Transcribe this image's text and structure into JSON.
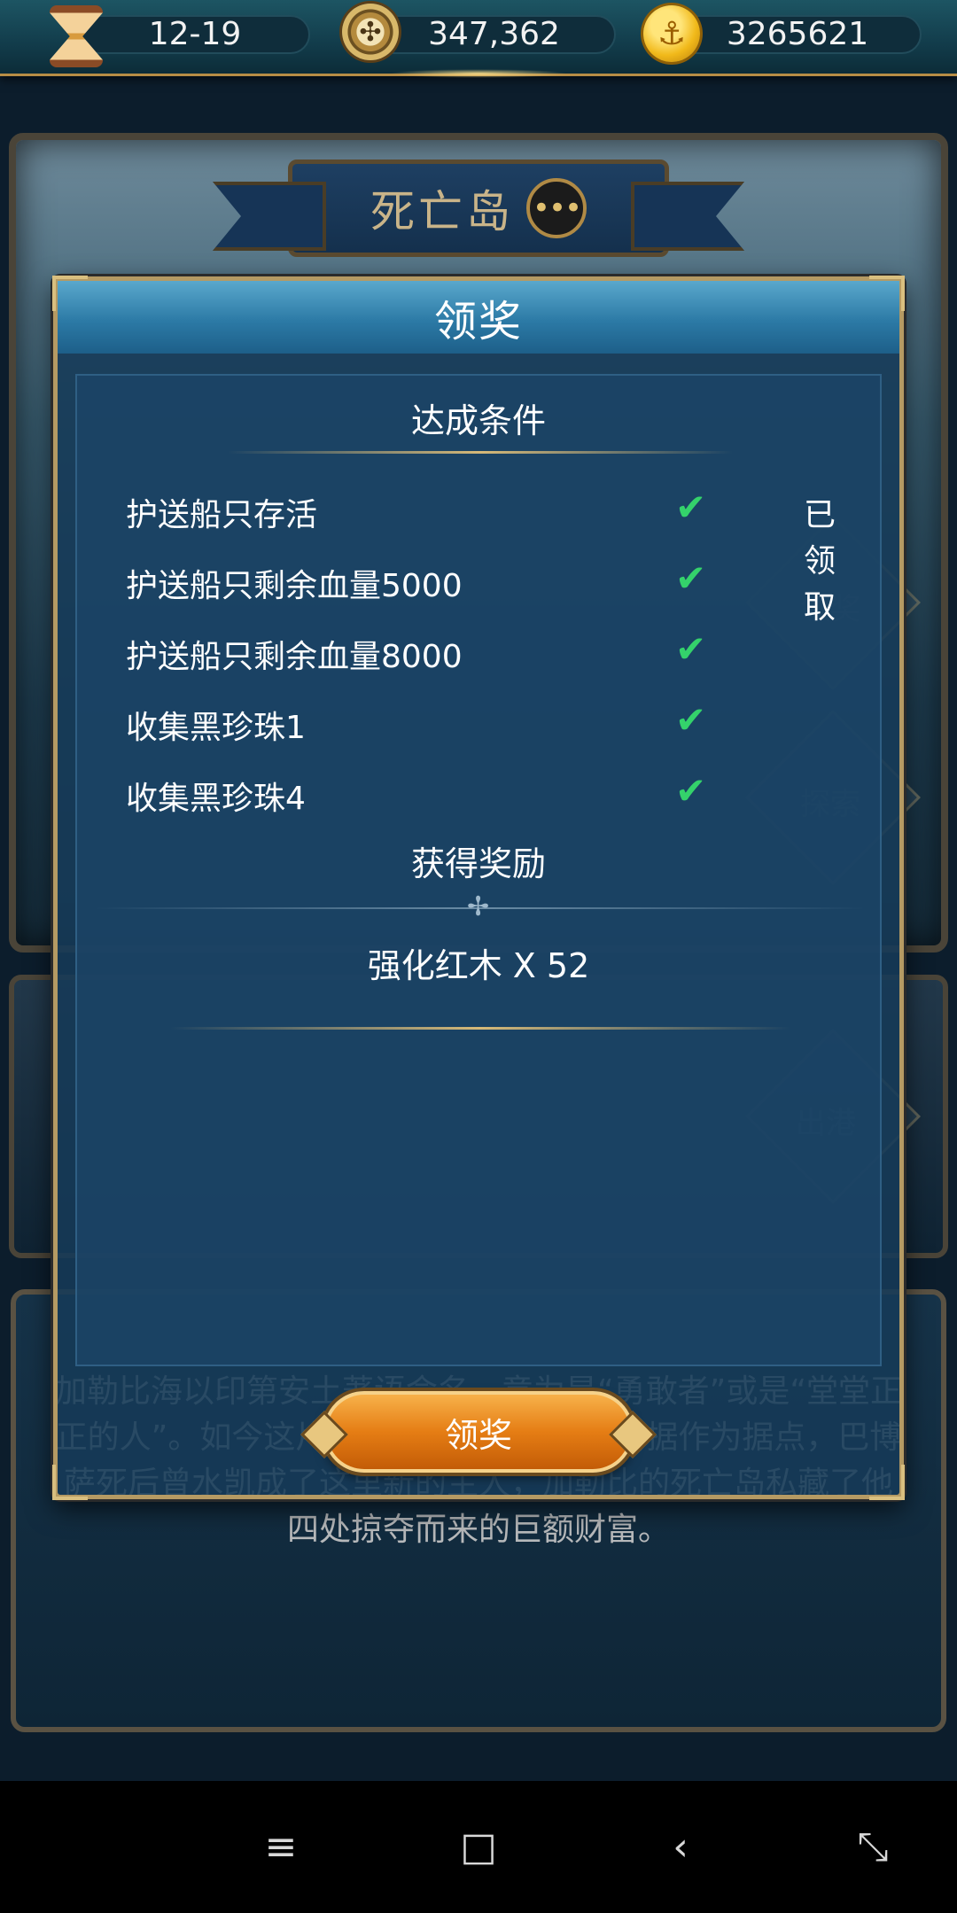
{
  "top_bar": {
    "resources": [
      {
        "icon": "hourglass-icon",
        "value": "12-19"
      },
      {
        "icon": "compass-icon",
        "value": "347,362"
      },
      {
        "icon": "gold-coin-icon",
        "value": "3265621"
      }
    ]
  },
  "island": {
    "title": "死亡岛",
    "chat_icon": "•••",
    "side_buttons": [
      "领奖",
      "探索",
      "出港"
    ]
  },
  "description": "加勒比海以印第安土著语命名，意为是“勇敢者”或是“堂堂正正的人”。如今这片海域却被凶残的海盗占据作为据点，巴博萨死后曾水凯成了这里新的主人，加勒比的死亡岛私藏了他四处掠夺而来的巨额财富。",
  "dialog": {
    "title": "领奖",
    "conditions_header": "达成条件",
    "conditions": [
      {
        "label": "护送船只存活",
        "check": "✔",
        "status": "已领取"
      },
      {
        "label": "护送船只剩余血量5000",
        "check": "✔",
        "status": ""
      },
      {
        "label": "护送船只剩余血量8000",
        "check": "✔",
        "status": ""
      },
      {
        "label": "收集黑珍珠1",
        "check": "✔",
        "status": ""
      },
      {
        "label": "收集黑珍珠4",
        "check": "✔",
        "status": ""
      }
    ],
    "rewards_header": "获得奖励",
    "reward_item": "强化红木 X 52",
    "claim_button": "领奖"
  },
  "nav_bar": {
    "menu": "≡",
    "home": "□",
    "back": "‹",
    "recent": "⤡"
  },
  "colors": {
    "accent_gold": "#b59a63",
    "check_green": "#34d26b",
    "button_orange": "#e57d14"
  }
}
